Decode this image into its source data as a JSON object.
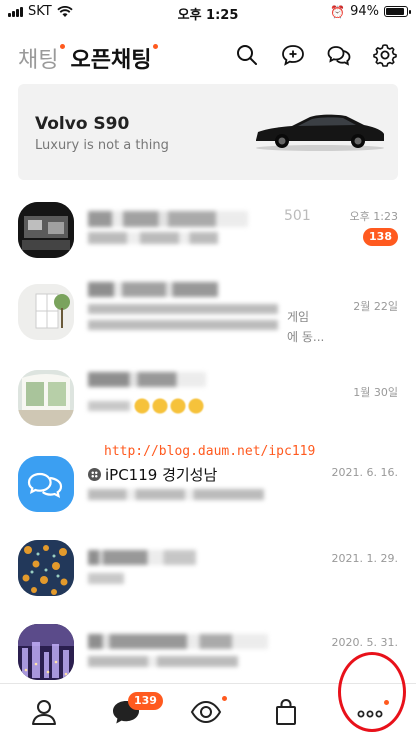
{
  "status_bar": {
    "carrier": "SKT",
    "time": "오후 1:25",
    "battery": "94%",
    "battery_level": 0.94
  },
  "header": {
    "tabs": [
      {
        "label": "채팅",
        "active": false,
        "dot": true
      },
      {
        "label": "오픈채팅",
        "active": true,
        "dot": true
      }
    ],
    "icons": [
      "search-icon",
      "new-chat-icon",
      "open-chat-icon",
      "settings-icon"
    ]
  },
  "banner": {
    "title": "Volvo S90",
    "subtitle": "Luxury is not a thing"
  },
  "watermark_url": "http://blog.daum.net/ipc119",
  "chats": [
    {
      "name": "",
      "name_partial": "501",
      "preview": "",
      "time": "오후 1:23",
      "unread": "138"
    },
    {
      "name": "",
      "preview": "",
      "preview_tail": "게임",
      "preview_tail2": "에 동...",
      "time": "2월 22일"
    },
    {
      "name": "",
      "preview": "",
      "time": "1월 30일"
    },
    {
      "name": "iPC119 경기성남",
      "preview": "",
      "time": "2021. 6. 16."
    },
    {
      "name": "",
      "preview": "",
      "time": "2021. 1. 29."
    },
    {
      "name": "",
      "preview": "",
      "time": "2020. 5. 31."
    }
  ],
  "nav": {
    "items": [
      "friends-icon",
      "chats-icon",
      "view-icon",
      "shopping-icon",
      "more-icon"
    ],
    "chat_badge": "139"
  },
  "colors": {
    "accent": "#ff5a1f",
    "highlight_circle": "#e8111a",
    "open_chat_blue": "#3b9ff2"
  }
}
